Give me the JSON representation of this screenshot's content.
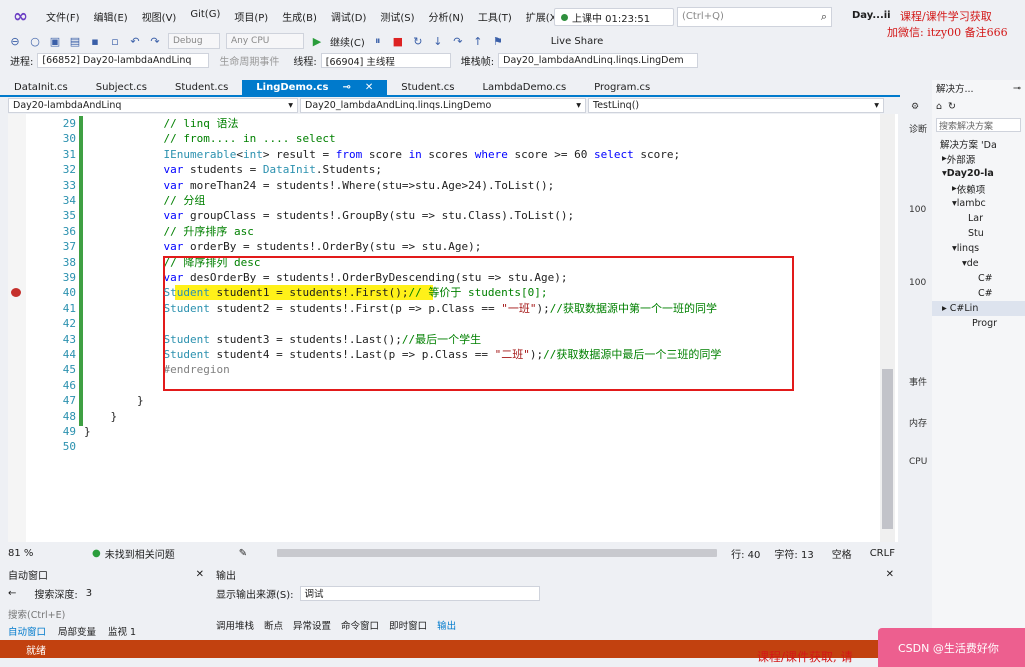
{
  "menubar": {
    "items": [
      "文件(F)",
      "编辑(E)",
      "视图(V)",
      "Git(G)",
      "项目(P)",
      "生成(B)",
      "调试(D)",
      "测试(S)",
      "分析(N)",
      "工具(T)",
      "扩展(X)"
    ],
    "running_label": "上课中 01:23:51",
    "quick_search": "(Ctrl+Q)",
    "window_title": "Day...ii"
  },
  "watermark": {
    "line1": "课程/课件学习获取",
    "line2": "加微信: itzy00 备注666",
    "bottom": "课程/课件获取, 请"
  },
  "toolbar": {
    "config": "Debug",
    "platform": "Any CPU",
    "continue": "继续(C)",
    "live_share": "Live Share"
  },
  "debugbar": {
    "process_label": "进程:",
    "process_value": "[66852] Day20-lambdaAndLinq",
    "lifecycle": "生命周期事件",
    "thread_label": "线程:",
    "thread_value": "[66904] 主线程",
    "stack_label": "堆栈帧:",
    "stack_value": "Day20_lambdaAndLinq.linqs.LingDem"
  },
  "tabs": [
    "DataInit.cs",
    "Subject.cs",
    "Student.cs",
    "LingDemo.cs",
    "Student.cs",
    "LambdaDemo.cs",
    "Program.cs"
  ],
  "active_tab": "LingDemo.cs",
  "navbar": {
    "project": "Day20-lambdaAndLinq",
    "class": "Day20_lambdaAndLinq.linqs.LingDemo",
    "method": "TestLinq()"
  },
  "code_lines": [
    {
      "n": "29",
      "t": "            // linq 语法"
    },
    {
      "n": "30",
      "t": "            // from.... in .... select"
    },
    {
      "n": "31",
      "t": "            IEnumerable<int> result = from score in scores where score >= 60 select score;"
    },
    {
      "n": "32",
      "t": "            var students = DataInit.Students;"
    },
    {
      "n": "33",
      "t": "            var moreThan24 = students!.Where(stu=>stu.Age>24).ToList();"
    },
    {
      "n": "34",
      "t": "            // 分组"
    },
    {
      "n": "35",
      "t": "            var groupClass = students!.GroupBy(stu => stu.Class).ToList();"
    },
    {
      "n": "36",
      "t": "            // 升序排序 asc"
    },
    {
      "n": "37",
      "t": "            var orderBy = students!.OrderBy(stu => stu.Age);"
    },
    {
      "n": "38",
      "t": "            // 降序排列 desc"
    },
    {
      "n": "39",
      "t": "            var desOrderBy = students!.OrderByDescending(stu => stu.Age);"
    },
    {
      "n": "40",
      "t": "            Student student1 = students!.First();// 等价于 students[0];"
    },
    {
      "n": "41",
      "t": "            Student student2 = students!.First(p => p.Class == \"一班\");//获取数据源中第一个一班的同学"
    },
    {
      "n": "42",
      "t": ""
    },
    {
      "n": "43",
      "t": "            Student student3 = students!.Last();//最后一个学生"
    },
    {
      "n": "44",
      "t": "            Student student4 = students!.Last(p => p.Class == \"二班\");//获取数据源中最后一个三班的同学"
    },
    {
      "n": "45",
      "t": "            #endregion"
    },
    {
      "n": "46",
      "t": ""
    },
    {
      "n": "47",
      "t": "        }"
    },
    {
      "n": "48",
      "t": "    }"
    },
    {
      "n": "49",
      "t": "}"
    },
    {
      "n": "50",
      "t": ""
    }
  ],
  "editor_status": {
    "zoom": "81 %",
    "issues": "未找到相关问题",
    "line": "行: 40",
    "char": "字符: 13",
    "space": "空格",
    "eol": "CRLF"
  },
  "right_panel": {
    "title": "解决方...",
    "search": "搜索解决方案",
    "nodes": [
      "解决方案 'Da",
      "外部源",
      "Day20-la",
      "依赖项",
      "lambc",
      "Lar",
      "Stu",
      "linqs",
      "de",
      "C#",
      "C#",
      "Lin",
      "Progr"
    ]
  },
  "side_strip": [
    "诊断",
    "100",
    "100",
    "事件",
    "内存",
    "CPU"
  ],
  "autos": {
    "title": "自动窗口",
    "search_placeholder": "搜索(Ctrl+E)",
    "depth_label": "搜索深度:",
    "depth_value": "3",
    "tabs": [
      "自动窗口",
      "局部变量",
      "监视 1"
    ]
  },
  "output": {
    "title": "输出",
    "source_label": "显示输出来源(S):",
    "source_value": "调试",
    "tabs": [
      "调用堆栈",
      "断点",
      "异常设置",
      "命令窗口",
      "即时窗口",
      "输出"
    ]
  },
  "statusbar": {
    "text": "就绪"
  },
  "pink_button": "CSDN @生活费好你"
}
